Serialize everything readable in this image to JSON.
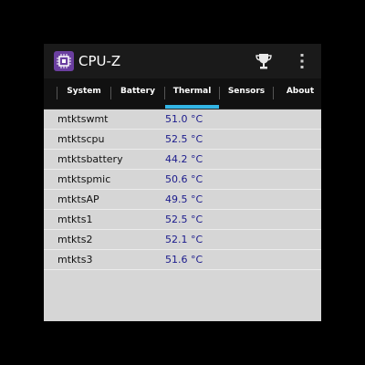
{
  "app": {
    "title": "CPU-Z",
    "icon": "cpu-chip-icon",
    "actions": {
      "trophy": "trophy-icon",
      "overflow": "overflow-menu-icon"
    }
  },
  "tabs": [
    {
      "label": "System"
    },
    {
      "label": "Battery"
    },
    {
      "label": "Thermal",
      "selected": true
    },
    {
      "label": "Sensors"
    },
    {
      "label": "About"
    }
  ],
  "thermal": {
    "sensors": [
      {
        "name": "mtktswmt",
        "value": "51.0 °C"
      },
      {
        "name": "mtktscpu",
        "value": "52.5 °C"
      },
      {
        "name": "mtktsbattery",
        "value": "44.2 °C"
      },
      {
        "name": "mtktspmic",
        "value": "50.6 °C"
      },
      {
        "name": "mtktsAP",
        "value": "49.5 °C"
      },
      {
        "name": "mtkts1",
        "value": "52.5 °C"
      },
      {
        "name": "mtkts2",
        "value": "52.1 °C"
      },
      {
        "name": "mtkts3",
        "value": "51.6 °C"
      }
    ]
  },
  "colors": {
    "accent": "#33b5e5",
    "value_text": "#1a1a8c",
    "background": "#d6d6d6",
    "actionbar": "#1a1a1a"
  }
}
